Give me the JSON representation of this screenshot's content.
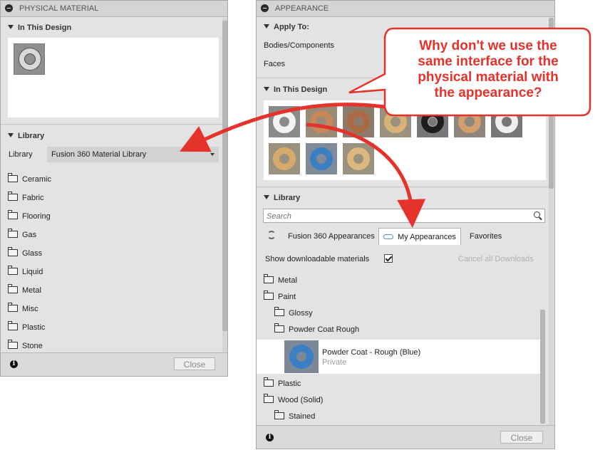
{
  "physical_panel": {
    "title": "PHYSICAL MATERIAL",
    "in_design_header": "In This Design",
    "library_header": "Library",
    "library_label": "Library",
    "library_value": "Fusion 360 Material Library",
    "folders": [
      "Ceramic",
      "Fabric",
      "Flooring",
      "Gas",
      "Glass",
      "Liquid",
      "Metal",
      "Misc",
      "Plastic",
      "Stone"
    ],
    "close_label": "Close",
    "info_glyph": "i"
  },
  "appearance_panel": {
    "title": "APPEARANCE",
    "apply_to_header": "Apply To:",
    "apply_options": [
      "Bodies/Components",
      "Faces"
    ],
    "in_design_header": "In This Design",
    "library_header": "Library",
    "search_placeholder": "Search",
    "tabs": [
      "Fusion 360 Appearances",
      "My Appearances",
      "Favorites"
    ],
    "show_downloadable_label": "Show downloadable materials",
    "cancel_downloads_label": "Cancel all Downloads",
    "tree": [
      {
        "label": "Metal",
        "indent": 0
      },
      {
        "label": "Paint",
        "indent": 0
      },
      {
        "label": "Glossy",
        "indent": 1
      },
      {
        "label": "Powder Coat Rough",
        "indent": 1
      }
    ],
    "selected_item": {
      "name": "Powder Coat - Rough (Blue)",
      "status": "Private"
    },
    "tree_after": [
      {
        "label": "Plastic",
        "indent": 0
      },
      {
        "label": "Wood (Solid)",
        "indent": 0
      },
      {
        "label": "Stained",
        "indent": 1
      }
    ],
    "close_label": "Close",
    "info_glyph": "i"
  },
  "callout": {
    "text_lines": [
      "Why don't we use the",
      "same interface for the",
      "physical material with",
      "the appearance?"
    ],
    "color": "#e5322b",
    "border_color": "#e5322b"
  },
  "colors": {
    "panel_bg": "#e3e3e3",
    "accent_red": "#e5322b",
    "selected_tab_bg": "#ffffff"
  }
}
